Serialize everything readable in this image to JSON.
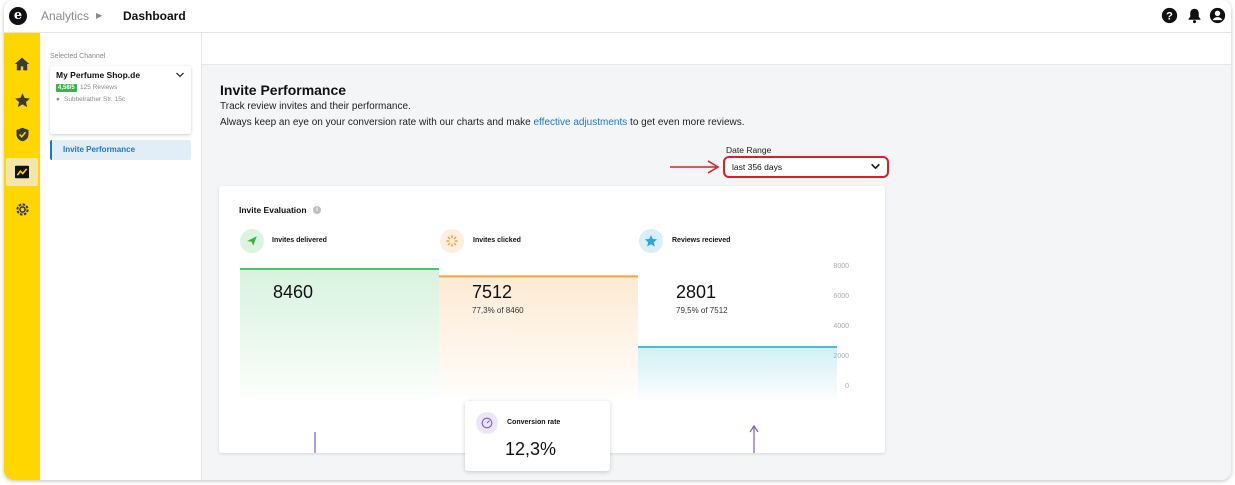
{
  "topbar": {
    "logo": "e",
    "breadcrumb_parent": "Analytics",
    "breadcrumb_current": "Dashboard"
  },
  "rail": {
    "icons": [
      "home-icon",
      "star-icon",
      "shield-icon",
      "chart-icon",
      "gear-icon"
    ],
    "active": "chart-icon"
  },
  "sidebar": {
    "selected_label": "Selected Channel",
    "channel_name": "My Perfume Shop.de",
    "rating": "4,58/5",
    "reviews": "125 Reviews",
    "address": "Subbelrather Str. 15c",
    "nav_item": "Invite Performance"
  },
  "main": {
    "title": "Invite Performance",
    "desc_line1": "Track review invites and their performance.",
    "desc_line2_pre": "Always keep an eye on your conversion rate with our charts and make ",
    "desc_line2_link": "effective adjustments",
    "desc_line2_post": " to get even more reviews.",
    "date_range_label": "Date Range",
    "date_range_value": "last 356 days"
  },
  "card": {
    "title": "Invite Evaluation",
    "stages": [
      {
        "label": "Invites delivered",
        "value": "8460",
        "sub": ""
      },
      {
        "label": "Invites clicked",
        "value": "7512",
        "sub": "77,3% of 8460"
      },
      {
        "label": "Reviews recieved",
        "value": "2801",
        "sub": "79,5% of 7512"
      }
    ],
    "conversion_label": "Conversion rate",
    "conversion_value": "12,3%"
  },
  "chart_data": {
    "type": "area",
    "categories": [
      "Invites delivered",
      "Invites clicked",
      "Reviews recieved"
    ],
    "values": [
      8460,
      7512,
      2801
    ],
    "ylim": [
      0,
      8000
    ],
    "yticks": [
      "8000",
      "6000",
      "4000",
      "2000",
      "0"
    ],
    "colors": [
      "#4cc46a",
      "#f3a23a",
      "#45bfd4"
    ]
  },
  "colors": {
    "rail": "#FFD600",
    "link": "#1d77c4",
    "highlight": "#d6202a",
    "connector": "#7d5bd8"
  }
}
